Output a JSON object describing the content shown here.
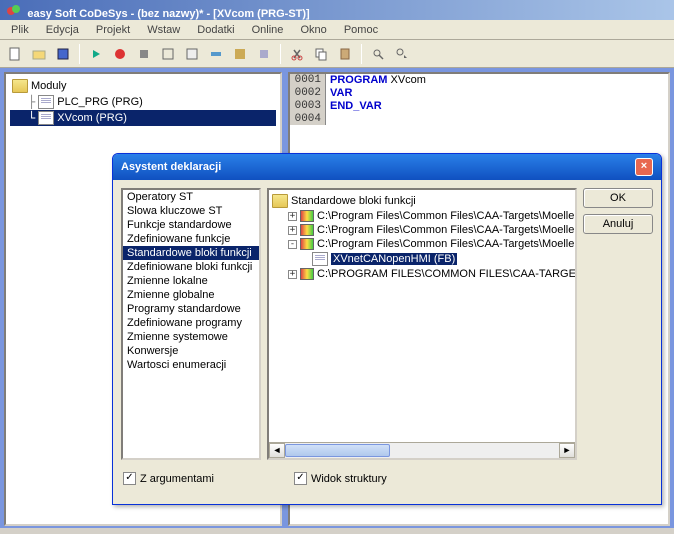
{
  "app": {
    "title": "easy Soft CoDeSys - (bez nazwy)* - [XVcom (PRG-ST)]"
  },
  "menu": {
    "items": [
      "Plik",
      "Edycja",
      "Projekt",
      "Wstaw",
      "Dodatki",
      "Online",
      "Okno",
      "Pomoc"
    ]
  },
  "tree": {
    "root": "Moduly",
    "items": [
      {
        "label": "PLC_PRG (PRG)",
        "selected": false
      },
      {
        "label": "XVcom (PRG)",
        "selected": true
      }
    ]
  },
  "code": {
    "lines": [
      {
        "num": "0001",
        "kw": "PROGRAM",
        "rest": " XVcom"
      },
      {
        "num": "0002",
        "kw": "VAR",
        "rest": ""
      },
      {
        "num": "0003",
        "kw": "END_VAR",
        "rest": ""
      },
      {
        "num": "0004",
        "kw": "",
        "rest": ""
      }
    ]
  },
  "dialog": {
    "title": "Asystent deklaracji",
    "categories": [
      "Operatory ST",
      "Slowa kluczowe ST",
      "Funkcje standardowe",
      "Zdefiniowane funkcje",
      "Standardowe bloki funkcji",
      "Zdefiniowane bloki funkcji",
      "Zmienne lokalne",
      "Zmienne globalne",
      "Programy standardowe",
      "Zdefiniowane programy",
      "Zmienne systemowe",
      "Konwersje",
      "Wartosci enumeracji"
    ],
    "selected_category_index": 4,
    "mid_header": "Standardowe bloki funkcji",
    "mid_items": [
      {
        "type": "lib",
        "label": "C:\\Program Files\\Common Files\\CAA-Targets\\Moeller V",
        "expand": "+"
      },
      {
        "type": "lib",
        "label": "C:\\Program Files\\Common Files\\CAA-Targets\\Moeller V",
        "expand": "+"
      },
      {
        "type": "lib",
        "label": "C:\\Program Files\\Common Files\\CAA-Targets\\Moeller V",
        "expand": "-"
      },
      {
        "type": "fb",
        "label": "XVnetCANopenHMI (FB)",
        "selected": true
      },
      {
        "type": "lib",
        "label": "C:\\PROGRAM FILES\\COMMON FILES\\CAA-TARGET",
        "expand": "+"
      }
    ],
    "buttons": {
      "ok": "OK",
      "cancel": "Anuluj"
    },
    "check1": "Z argumentami",
    "check2": "Widok struktury"
  }
}
